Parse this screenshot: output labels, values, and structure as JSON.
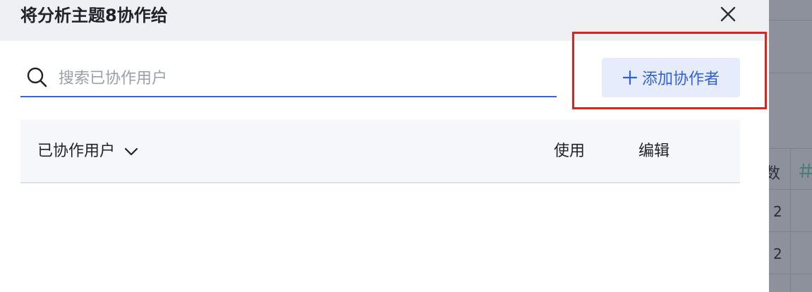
{
  "dialog": {
    "title": "将分析主题8协作给",
    "close_icon": "close-icon"
  },
  "search": {
    "placeholder": "搜索已协作用户",
    "value": "",
    "icon": "search-icon"
  },
  "add_button": {
    "label": "添加协作者",
    "icon": "plus-icon"
  },
  "table": {
    "columns": {
      "users": "已协作用户",
      "use": "使用",
      "edit": "编辑"
    },
    "rows": []
  },
  "background": {
    "header_text": "数",
    "rows": [
      "2",
      "2"
    ]
  },
  "colors": {
    "accent": "#3161d8",
    "highlight": "#e0221b",
    "header_bg": "#eef0f4"
  }
}
